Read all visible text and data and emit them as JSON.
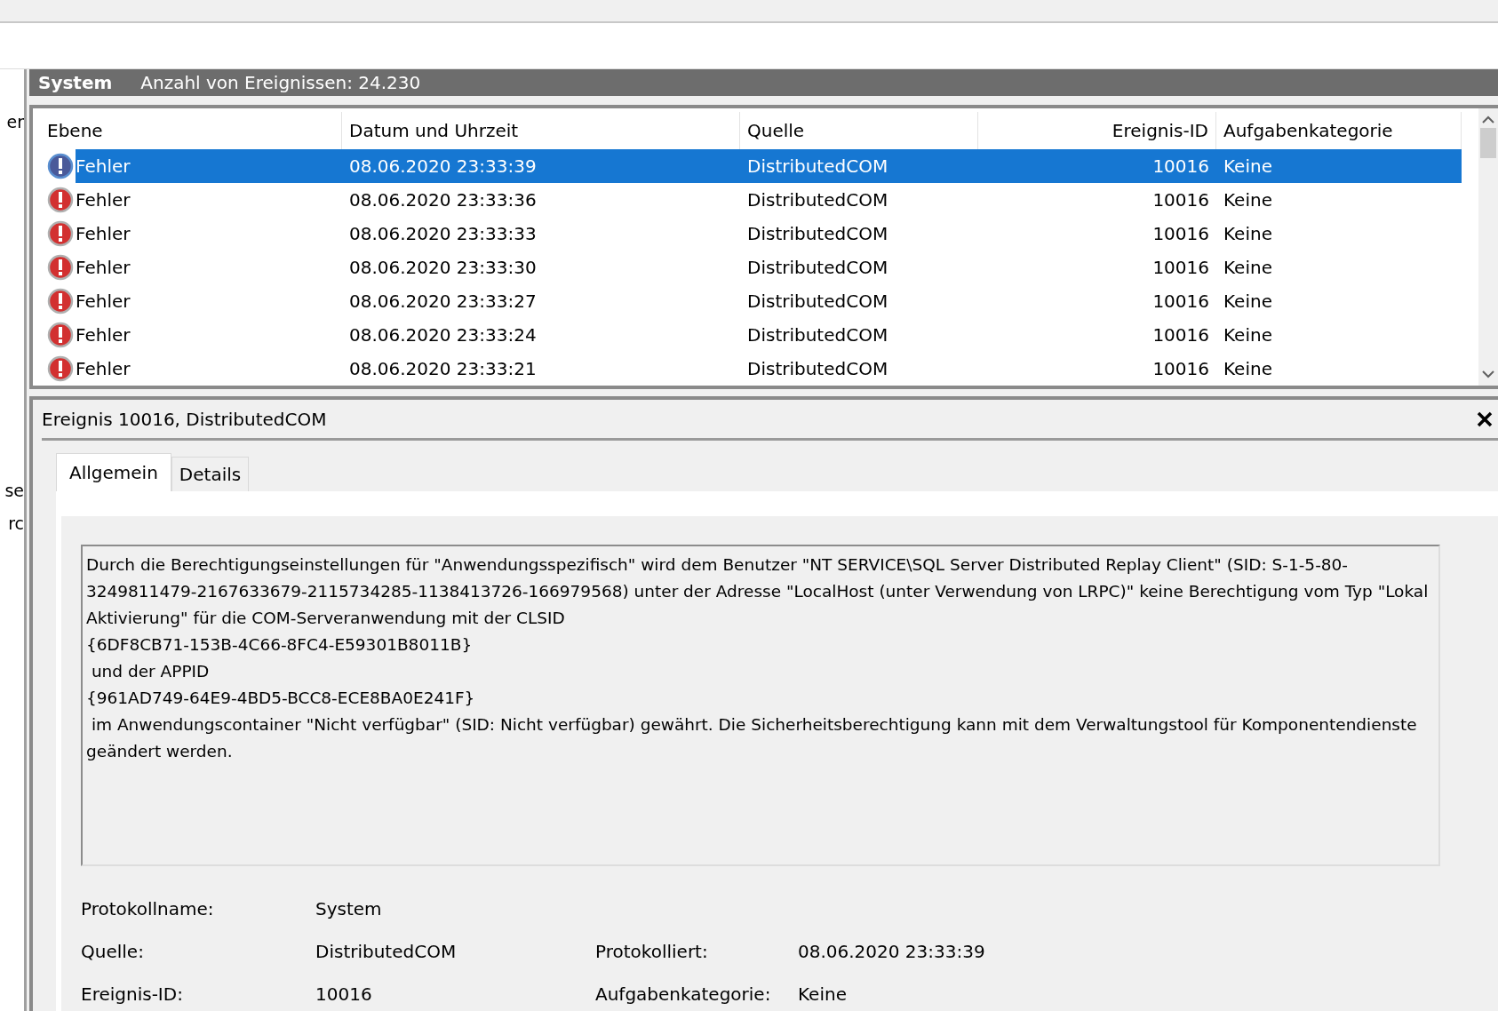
{
  "left_pane": {
    "fragments": [
      "er",
      "se",
      "rc"
    ]
  },
  "log_header": {
    "name": "System",
    "count": "Anzahl von Ereignissen: 24.230"
  },
  "table": {
    "columns": [
      "Ebene",
      "Datum und Uhrzeit",
      "Quelle",
      "Ereignis-ID",
      "Aufgabenkategorie"
    ],
    "rows": [
      {
        "level": "Fehler",
        "datetime": "08.06.2020 23:33:39",
        "source": "DistributedCOM",
        "event_id": "10016",
        "category": "Keine",
        "selected": true
      },
      {
        "level": "Fehler",
        "datetime": "08.06.2020 23:33:36",
        "source": "DistributedCOM",
        "event_id": "10016",
        "category": "Keine",
        "selected": false
      },
      {
        "level": "Fehler",
        "datetime": "08.06.2020 23:33:33",
        "source": "DistributedCOM",
        "event_id": "10016",
        "category": "Keine",
        "selected": false
      },
      {
        "level": "Fehler",
        "datetime": "08.06.2020 23:33:30",
        "source": "DistributedCOM",
        "event_id": "10016",
        "category": "Keine",
        "selected": false
      },
      {
        "level": "Fehler",
        "datetime": "08.06.2020 23:33:27",
        "source": "DistributedCOM",
        "event_id": "10016",
        "category": "Keine",
        "selected": false
      },
      {
        "level": "Fehler",
        "datetime": "08.06.2020 23:33:24",
        "source": "DistributedCOM",
        "event_id": "10016",
        "category": "Keine",
        "selected": false
      },
      {
        "level": "Fehler",
        "datetime": "08.06.2020 23:33:21",
        "source": "DistributedCOM",
        "event_id": "10016",
        "category": "Keine",
        "selected": false
      }
    ]
  },
  "detail": {
    "title": "Ereignis 10016, DistributedCOM",
    "tabs": [
      {
        "label": "Allgemein",
        "selected": true
      },
      {
        "label": "Details",
        "selected": false
      }
    ],
    "description": "Durch die Berechtigungseinstellungen für \"Anwendungsspezifisch\" wird dem Benutzer \"NT SERVICE\\SQL Server Distributed Replay Client\" (SID: S-1-5-80-3249811479-2167633679-2115734285-1138413726-166979568) unter der Adresse \"LocalHost (unter Verwendung von LRPC)\" keine Berechtigung vom Typ \"Lokal Aktivierung\" für die COM-Serveranwendung mit der CLSID\n{6DF8CB71-153B-4C66-8FC4-E59301B8011B}\n und der APPID\n{961AD749-64E9-4BD5-BCC8-ECE8BA0E241F}\n im Anwendungscontainer \"Nicht verfügbar\" (SID: Nicht verfügbar) gewährt. Die Sicherheitsberechtigung kann mit dem Verwaltungstool für Komponentendienste geändert werden.",
    "fields": [
      [
        {
          "label": "Protokollname:",
          "value": "System"
        }
      ],
      [
        {
          "label": "Quelle:",
          "value": "DistributedCOM"
        },
        {
          "label": "Protokolliert:",
          "value": "08.06.2020 23:33:39"
        }
      ],
      [
        {
          "label": "Ereignis-ID:",
          "value": "10016"
        },
        {
          "label": "Aufgabenkategorie:",
          "value": "Keine"
        }
      ]
    ]
  }
}
